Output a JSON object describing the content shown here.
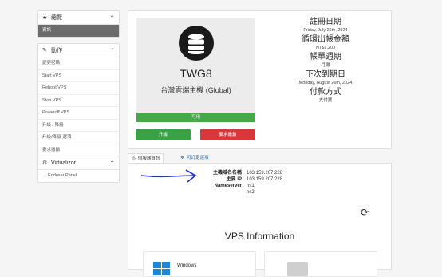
{
  "sidebar": {
    "overview": {
      "title": "總覽",
      "items": [
        {
          "label": "資訊",
          "active": true
        }
      ]
    },
    "actions": {
      "title": "動作",
      "items": [
        {
          "label": "變更密碼"
        },
        {
          "label": "Start VPS"
        },
        {
          "label": "Reboot VPS"
        },
        {
          "label": "Stop VPS"
        },
        {
          "label": "Poweroff VPS"
        },
        {
          "label": "升級 / 降級"
        },
        {
          "label": "升級/降級-選項"
        },
        {
          "label": "要求撤銷"
        }
      ]
    },
    "virtualizor": {
      "title": "Virtualizor",
      "items": [
        {
          "label": "Enduser Panel"
        }
      ]
    }
  },
  "product": {
    "name": "TWG8",
    "subtitle": "台灣雲端主機 (Global)",
    "status": "可用",
    "upgrade_label": "升級",
    "cancel_label": "要求撤銷"
  },
  "billing": {
    "reg_date_label": "註冊日期",
    "reg_date": "Friday, July 26th, 2024",
    "first_amount_label": "循環出帳金額",
    "first_amount": "NT$1,200",
    "cycle_label": "帳單週期",
    "cycle": "月繳",
    "due_label": "下次到期日",
    "due_date": "Monday, August 26th, 2024",
    "payment_label": "付款方式",
    "payment": "支付寶"
  },
  "tabs": {
    "server_info": "伺服器資訊",
    "addons": "可訂定選項"
  },
  "server": {
    "rows": [
      {
        "key": "主機域名名稱",
        "value": "103.159.207.228"
      },
      {
        "key": "主要 IP",
        "value": "103.159.207.228"
      },
      {
        "key": "Nameserver",
        "value": "ns1"
      },
      {
        "key": "",
        "value": "ns2"
      }
    ]
  },
  "vps": {
    "title": "VPS Information",
    "os_label": "Windows"
  },
  "colors": {
    "success": "#45a84a",
    "danger": "#d9383a",
    "link": "#2a6fb0",
    "sidebar_active": "#6c6c6c"
  }
}
